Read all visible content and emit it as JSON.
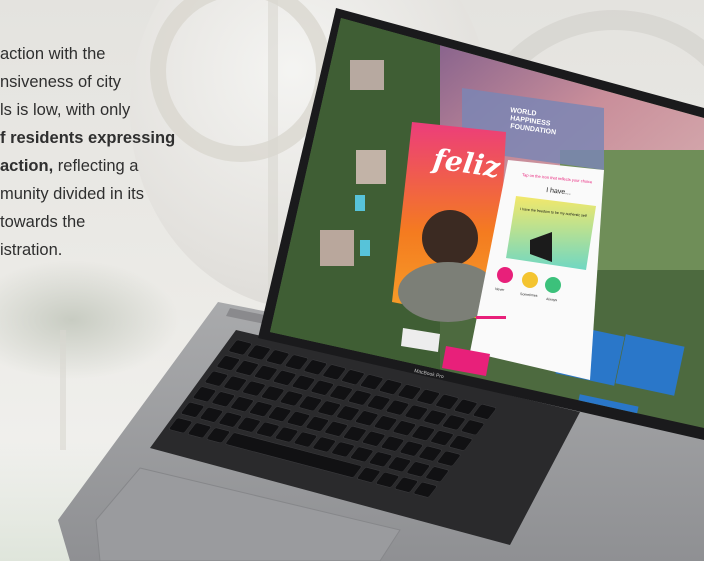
{
  "paragraph": {
    "line1": "action with the",
    "line2": "nsiveness of city",
    "line3": "ls is low, with only",
    "line4_bold": "f residents expressing",
    "line5_bold": "action,",
    "line5_rest": " reflecting a",
    "line6": "munity divided in its",
    "line7": "towards the",
    "line8": "istration."
  },
  "app_card": {
    "logo_text_1": "WORLD",
    "logo_text_2": "HAPPINESS",
    "logo_text_3": "FOUNDATION",
    "poster_title": "feliz",
    "prompt": "Tap on the icon that reflects your choice",
    "heading": "I have...",
    "question": "I have the freedom to be my authentic self",
    "options": [
      "Never",
      "Sometimes",
      "Always"
    ],
    "progress_label": "progress"
  },
  "laptop": {
    "model": "MacBook Pro"
  },
  "colors": {
    "accent_pink": "#e8207a",
    "card_bg": "#ffffff",
    "poster_orange": "#f47b20"
  }
}
